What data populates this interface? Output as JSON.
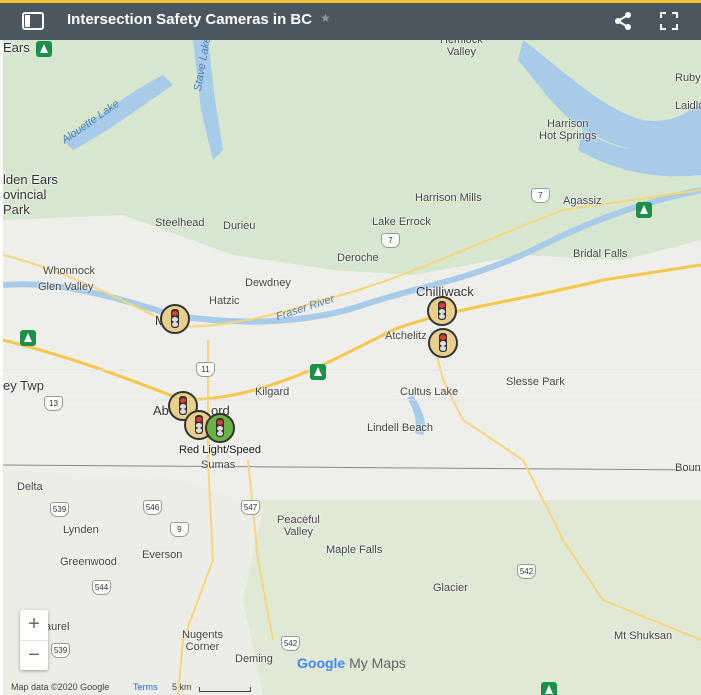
{
  "header": {
    "title": "Intersection Safety Cameras in BC",
    "star_glyph": "★",
    "colors": {
      "bar": "#4a5760",
      "accent": "#f2c12e"
    }
  },
  "map": {
    "labels": {
      "ears": "Ears",
      "alouette_lake": "Alouette Lake",
      "stave_lake": "Stave Lake",
      "hemlock_valley": "Hemlock\nValley",
      "ruby": "Ruby",
      "laidlaw": "Laidla",
      "harrison_hot_springs": "Harrison\nHot Springs",
      "golden_ears_park": "lden Ears\novincial\nPark",
      "harrison_mills": "Harrison Mills",
      "agassiz": "Agassiz",
      "steelhead": "Steelhead",
      "durieu": "Durieu",
      "lake_errock": "Lake Errock",
      "bridal_falls": "Bridal Falls",
      "whonnock": "Whonnock",
      "deroche": "Deroche",
      "glen_valley": "Glen Valley",
      "dewdney": "Dewdney",
      "chilliwack": "Chilliwack",
      "hatzic": "Hatzic",
      "fraser_river": "Fraser River",
      "mission": "M",
      "atchelitz": "Atchelitz",
      "langley_twp": "ey Twp",
      "kilgard": "Kilgard",
      "cultus_lake": "Cultus Lake",
      "slesse_park": "Slesse Park",
      "abbotsford_a": "Ab",
      "abbotsford_b": "ord",
      "lindell_beach": "Lindell Beach",
      "sumas": "Sumas",
      "boundary": "Boun",
      "delta": "Delta",
      "peaceful_valley": "Peaceful\nValley",
      "lynden": "Lynden",
      "maple_falls": "Maple Falls",
      "everson": "Everson",
      "greenwood": "Greenwood",
      "glacier": "Glacier",
      "laurel": "aurel",
      "nugents_corner": "Nugents\nCorner",
      "mt_shuksan": "Mt Shuksan",
      "deming": "Deming"
    },
    "shields": {
      "s7a": "7",
      "s7b": "7",
      "s11": "11",
      "s13": "13",
      "s539a": "539",
      "s546": "546",
      "s547": "547",
      "s9": "9",
      "s544": "544",
      "s542a": "542",
      "s542b": "542",
      "s539b": "539"
    },
    "marker_label": "Red Light/Speed",
    "marker_colors": {
      "camera": "#e8cf8b",
      "combo": "#69b344",
      "red": "#e53935"
    },
    "parks": [
      "park-icon",
      "park-icon",
      "park-icon",
      "park-icon",
      "park-icon"
    ]
  },
  "controls": {
    "zoom_in": "+",
    "zoom_out": "−"
  },
  "branding": {
    "google": "Google",
    "mymaps": "My Maps"
  },
  "attribution": {
    "map_data": "Map data ©2020 Google",
    "terms": "Terms",
    "scale": "5 km"
  }
}
